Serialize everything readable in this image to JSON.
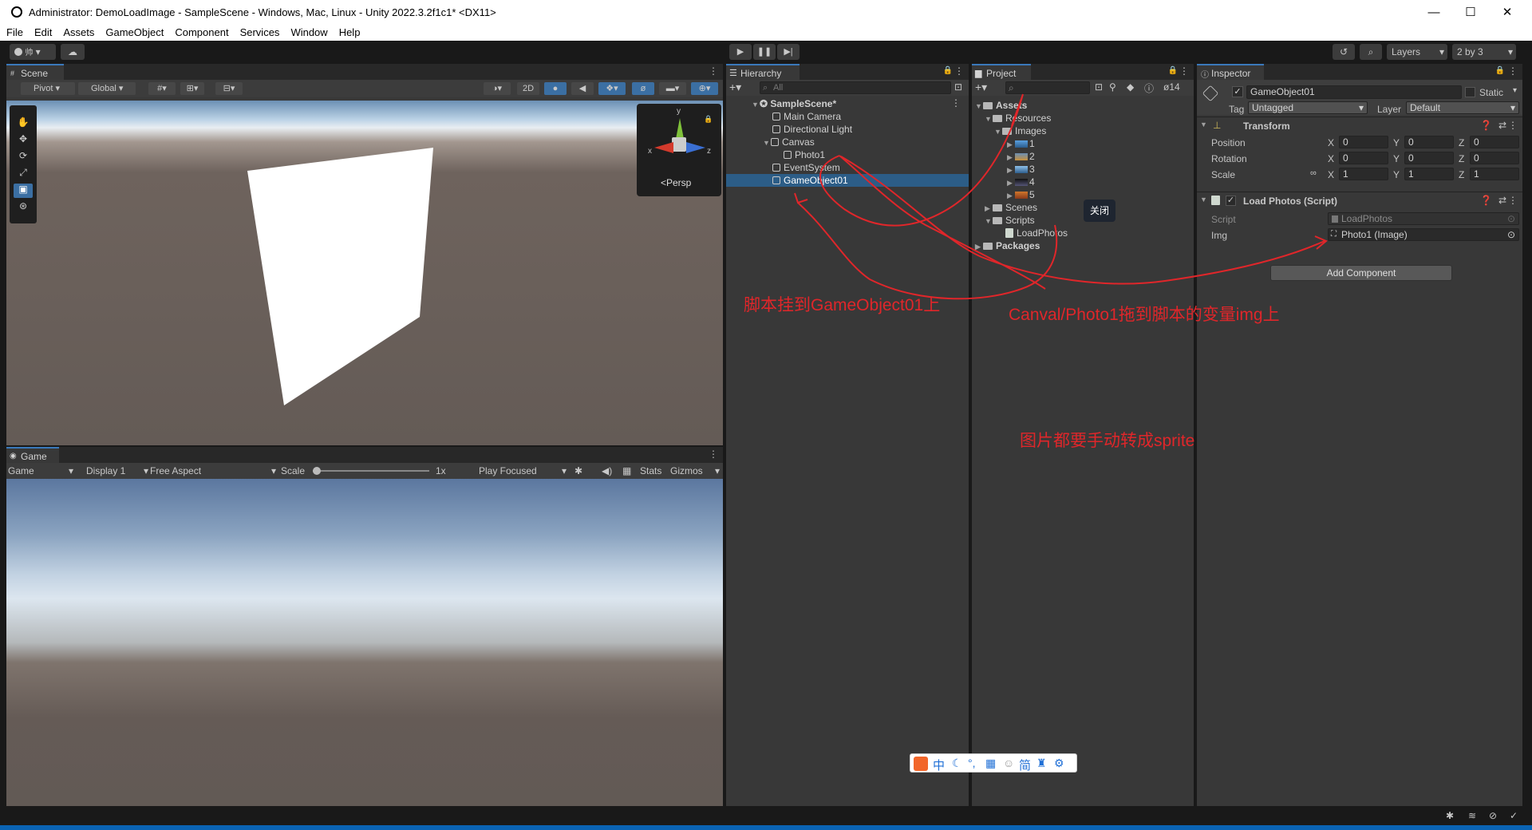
{
  "window": {
    "title": "Administrator: DemoLoadImage - SampleScene - Windows, Mac, Linux - Unity 2022.3.2f1c1* <DX11>",
    "controls": {
      "minimize": "—",
      "maximize": "☐",
      "close": "✕"
    }
  },
  "menu": [
    "File",
    "Edit",
    "Assets",
    "GameObject",
    "Component",
    "Services",
    "Window",
    "Help"
  ],
  "toolbar": {
    "account_label": "帅",
    "layers": "Layers",
    "layout": "2 by 3"
  },
  "scene": {
    "tab": "Scene",
    "pivot": "Pivot",
    "global": "Global",
    "btn_2d": "2D",
    "persp": "<Persp",
    "gizmo_axes": {
      "x": "x",
      "y": "y",
      "z": "z"
    }
  },
  "game": {
    "tab": "Game",
    "mode": "Game",
    "display": "Display 1",
    "aspect": "Free Aspect",
    "scale_label": "Scale",
    "scale_value": "1x",
    "play_focused": "Play Focused",
    "stats": "Stats",
    "gizmos": "Gizmos"
  },
  "hierarchy": {
    "tab": "Hierarchy",
    "search_placeholder": "All",
    "scene": "SampleScene*",
    "items": [
      {
        "label": "Main Camera",
        "depth": 1
      },
      {
        "label": "Directional Light",
        "depth": 1
      },
      {
        "label": "Canvas",
        "depth": 1
      },
      {
        "label": "Photo1",
        "depth": 2
      },
      {
        "label": "EventSystem",
        "depth": 1
      },
      {
        "label": "GameObject01",
        "depth": 1,
        "selected": true
      }
    ]
  },
  "project": {
    "tab": "Project",
    "hidden_count": "14",
    "tree": {
      "assets": "Assets",
      "resources": "Resources",
      "images": "Images",
      "image_items": [
        "1",
        "2",
        "3",
        "4",
        "5"
      ],
      "scenes": "Scenes",
      "scripts": "Scripts",
      "load_photos": "LoadPhotos",
      "packages": "Packages"
    },
    "tooltip": "关闭"
  },
  "inspector": {
    "tab": "Inspector",
    "object_name": "GameObject01",
    "static_label": "Static",
    "tag_label": "Tag",
    "tag_value": "Untagged",
    "layer_label": "Layer",
    "layer_value": "Default",
    "transform": {
      "title": "Transform",
      "rows": [
        {
          "label": "Position",
          "x": "0",
          "y": "0",
          "z": "0"
        },
        {
          "label": "Rotation",
          "x": "0",
          "y": "0",
          "z": "0"
        },
        {
          "label": "Scale",
          "x": "1",
          "y": "1",
          "z": "1"
        }
      ],
      "axis_x": "X",
      "axis_y": "Y",
      "axis_z": "Z"
    },
    "script_component": {
      "title": "Load Photos (Script)",
      "script_label": "Script",
      "script_value": "LoadPhotos",
      "img_label": "Img",
      "img_value": "Photo1 (Image)"
    },
    "add_component": "Add Component"
  },
  "annotations": {
    "note1": "脚本挂到GameObject01上",
    "note2": "Canval/Photo1拖到脚本的变量img上",
    "note3": "图片都要手动转成sprite"
  },
  "ime_bar": [
    "中",
    "简"
  ],
  "colors": {
    "accent_blue": "#2c5d87",
    "annotation_red": "#e0262a",
    "unity_dark": "#383838",
    "taskbar_blue": "#0a63b3"
  }
}
